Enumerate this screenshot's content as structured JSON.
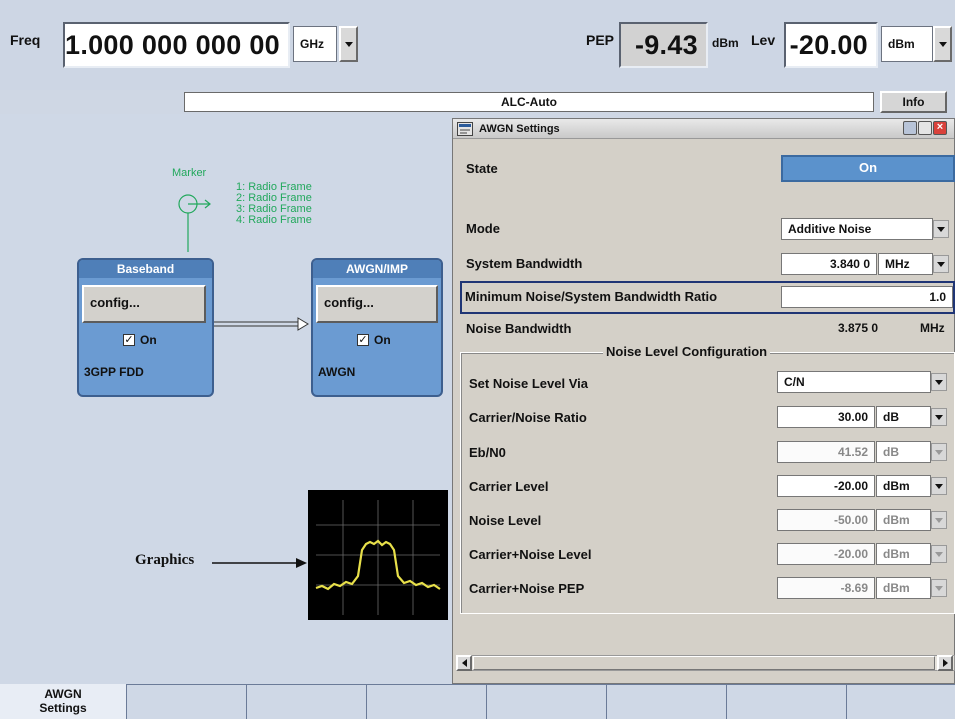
{
  "header": {
    "freq_label": "Freq",
    "freq_value": "1.000 000 000 00",
    "freq_unit": "GHz",
    "pep_label": "PEP",
    "pep_value": "-9.43",
    "pep_unit": "dBm",
    "lev_label": "Lev",
    "lev_value": "-20.00",
    "lev_unit": "dBm"
  },
  "status_bar": {
    "text": "ALC-Auto",
    "info_label": "Info"
  },
  "diagram": {
    "marker_label": "Marker",
    "marker_items": [
      "1: Radio Frame",
      "2: Radio Frame",
      "3: Radio Frame",
      "4: Radio Frame"
    ],
    "baseband": {
      "title": "Baseband",
      "config_label": "config...",
      "on_label": "On",
      "footer": "3GPP FDD"
    },
    "awgn": {
      "title": "AWGN/IMP",
      "config_label": "config...",
      "on_label": "On",
      "footer": "AWGN"
    },
    "graphics_label": "Graphics"
  },
  "dialog": {
    "title": "AWGN Settings",
    "state": {
      "label": "State",
      "value": "On"
    },
    "mode": {
      "label": "Mode",
      "value": "Additive Noise"
    },
    "system_bandwidth": {
      "label": "System Bandwidth",
      "value": "3.840 0",
      "unit": "MHz"
    },
    "min_ratio": {
      "label": "Minimum Noise/System Bandwidth Ratio",
      "value": "1.0"
    },
    "noise_bandwidth": {
      "label": "Noise Bandwidth",
      "value": "3.875 0",
      "unit": "MHz"
    },
    "group_title": "Noise Level Configuration",
    "set_via": {
      "label": "Set Noise Level Via",
      "value": "C/N"
    },
    "cn_ratio": {
      "label": "Carrier/Noise Ratio",
      "value": "30.00",
      "unit": "dB"
    },
    "eb_n0": {
      "label": "Eb/N0",
      "value": "41.52",
      "unit": "dB"
    },
    "carrier_level": {
      "label": "Carrier Level",
      "value": "-20.00",
      "unit": "dBm"
    },
    "noise_level": {
      "label": "Noise Level",
      "value": "-50.00",
      "unit": "dBm"
    },
    "carrier_noise_level": {
      "label": "Carrier+Noise Level",
      "value": "-20.00",
      "unit": "dBm"
    },
    "carrier_noise_pep": {
      "label": "Carrier+Noise PEP",
      "value": "-8.69",
      "unit": "dBm"
    }
  },
  "tabs": {
    "awgn_tab_line1": "AWGN",
    "awgn_tab_line2": "Settings"
  },
  "colors": {
    "accent_blue": "#5b92cc",
    "block_blue": "#6b9bd2",
    "marker_green": "#22a85c",
    "trace_yellow": "#e8e04a"
  }
}
